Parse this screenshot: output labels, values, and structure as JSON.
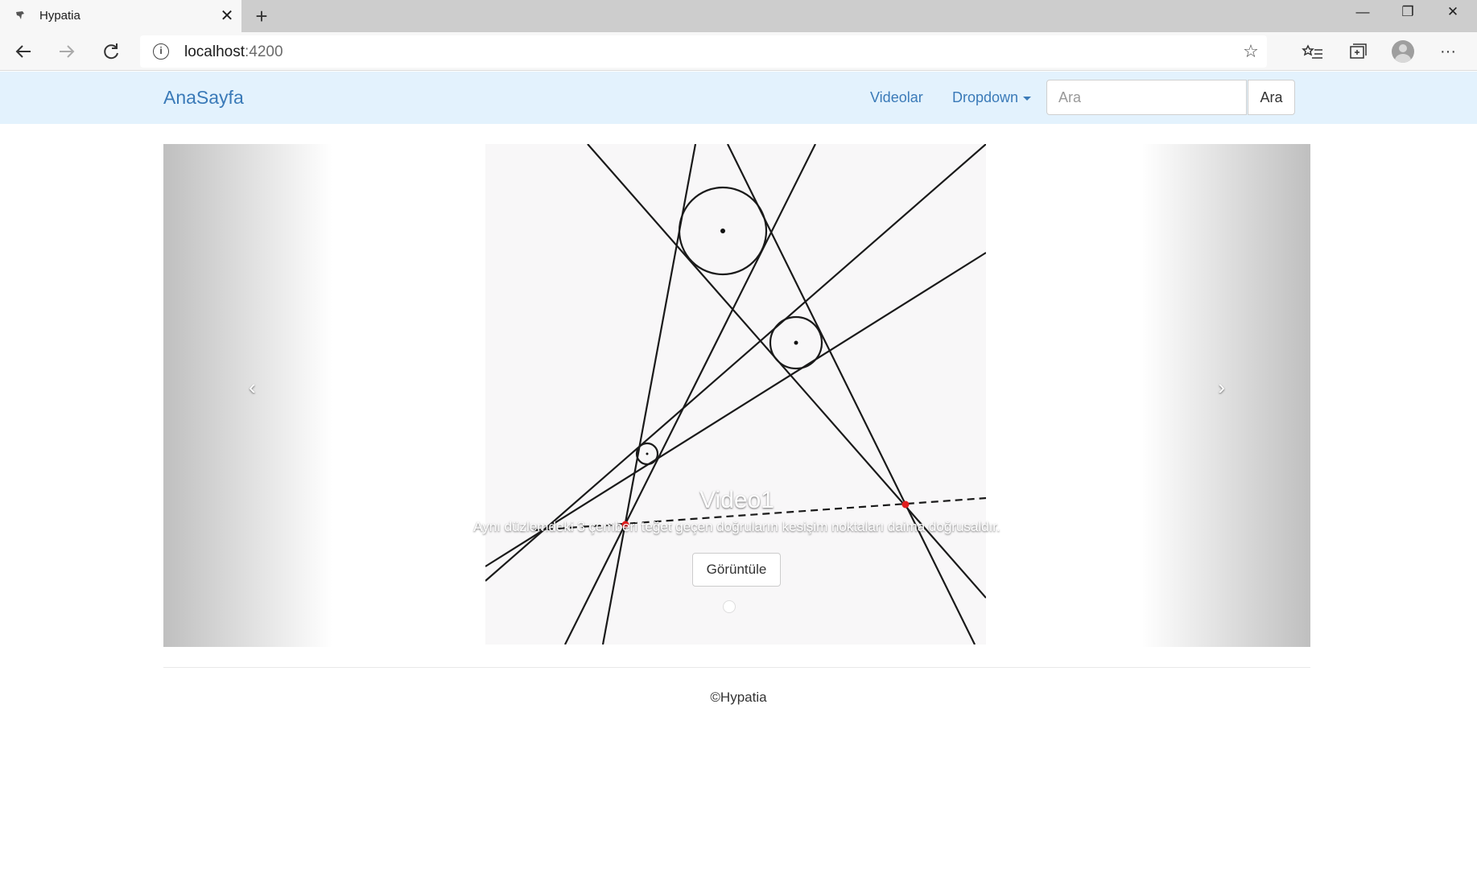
{
  "browser": {
    "tab_title": "Hypatia",
    "url_host": "localhost",
    "url_port": ":4200"
  },
  "navbar": {
    "brand": "AnaSayfa",
    "links": [
      "Videolar",
      "Dropdown"
    ],
    "search_placeholder": "Ara",
    "search_button": "Ara"
  },
  "carousel": {
    "prev_glyph": "‹",
    "next_glyph": "›",
    "slides": [
      {
        "title": "Video1",
        "description": "Aynı düzlemdeki 3 çemberi teğet geçen doğruların kesişim noktaları daima doğrusaldır.",
        "button": "Görüntüle"
      }
    ]
  },
  "footer": {
    "text": "©Hypatia"
  },
  "colors": {
    "navbar_bg": "#e3f2fd",
    "link": "#3a7ab8"
  }
}
